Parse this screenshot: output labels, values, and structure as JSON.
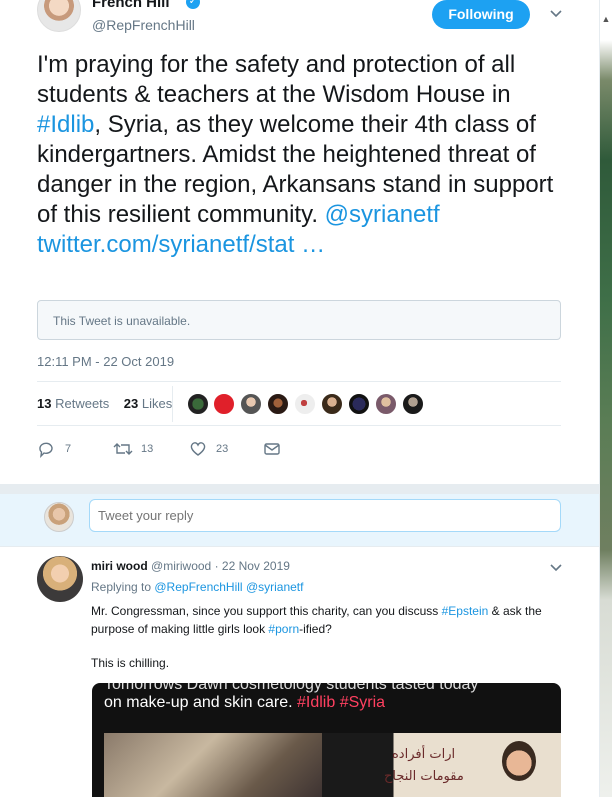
{
  "tweet": {
    "author_name": "French Hill",
    "author_handle": "@RepFrenchHill",
    "follow_label": "Following",
    "text_parts": {
      "p1": "I'm praying for the safety and protection of all students & teachers at the Wisdom House in ",
      "hashtag": "#Idlib",
      "p2": ", Syria, as they welcome their 4th class of kindergartners. Amidst the heightened threat of danger in the region, Arkansans stand in support of this resilient community. ",
      "mention": "@syrianetf",
      "link": "twitter.com/syrianetf/stat …"
    },
    "quoted_unavailable": "This Tweet is unavailable.",
    "timestamp": "12:11 PM - 22 Oct 2019",
    "retweets_count": "13",
    "retweets_label": "Retweets",
    "likes_count": "23",
    "likes_label": "Likes",
    "actions": {
      "reply_count": "7",
      "retweet_count": "13",
      "like_count": "23"
    }
  },
  "reply_box": {
    "placeholder": "Tweet your reply"
  },
  "reply": {
    "name": "miri wood",
    "handle": "@miriwood",
    "date": "· 22 Nov 2019",
    "replying_prefix": "Replying to ",
    "replying_to_1": "@RepFrenchHill",
    "replying_to_2": "@syrianetf",
    "text_p1": "Mr. Congressman, since you support this charity, can you discuss ",
    "tag_epstein": "#Epstein",
    "text_p2": " & ask the purpose of making little girls look ",
    "tag_porn": "#porn",
    "text_p3": "-ified?",
    "text_line2": "This is chilling.",
    "media": {
      "top_text": "Tomorrows Dawn cosmetology students tasted today",
      "caption": "on make-up and skin care. ",
      "tag1": "#Idlib",
      "tag2": "#Syria",
      "sign_line1": "ارات أفراده",
      "sign_line2": "مقومات النجاح"
    }
  },
  "colors": {
    "accent": "#1da1f2",
    "link": "#1b95e0",
    "muted": "#657786",
    "border": "#e6ecf0"
  }
}
